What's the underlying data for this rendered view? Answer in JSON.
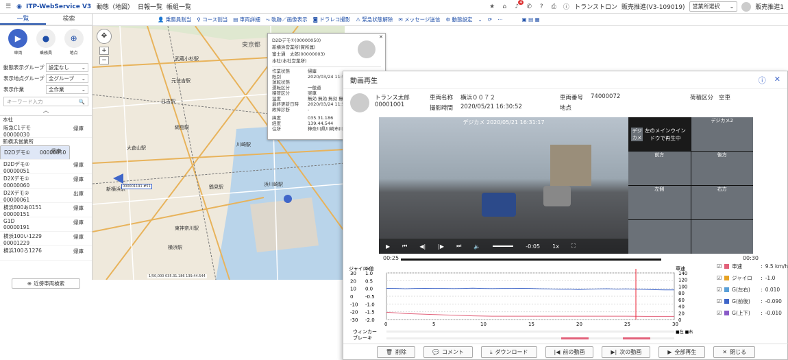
{
  "topbar": {
    "logo": "ITP-WebService V3",
    "menu": [
      "動態（地図）",
      "日報一覧",
      "帳組一覧"
    ],
    "company": "トランストロン",
    "sales": "販売推進(V3-109019)",
    "office": "営業所選択",
    "user": "販売推進1",
    "badge": "4"
  },
  "toolbar": [
    "乗務員割当",
    "コース割当",
    "車両詳細",
    "軌跡／画像表示",
    "ドラレコ撮影",
    "緊急状態解除",
    "メッセージ送信",
    "動態設定"
  ],
  "left": {
    "tabs": [
      "一覧",
      "検索"
    ],
    "modes": [
      {
        "label": "車両"
      },
      {
        "label": "乗務員"
      },
      {
        "label": "地点"
      }
    ],
    "filters": [
      {
        "label": "動態表示グループ",
        "value": "設定なし"
      },
      {
        "label": "表示地点グループ",
        "value": "全グループ"
      },
      {
        "label": "表示作業",
        "value": "全作業"
      }
    ],
    "keyword_placeholder": "キーワード入力",
    "groups": [
      {
        "name": "本社",
        "vehicles": [
          {
            "name": "阪急C1デモ",
            "id": "00000030",
            "status": "帰庫"
          }
        ]
      },
      {
        "name": "新横浜営業所",
        "vehicles": [
          {
            "name": "D2Dデモ①",
            "id": "00000050",
            "status": "帰庫",
            "selected": true
          },
          {
            "name": "D2Dデモ②",
            "id": "00000051",
            "status": "帰庫"
          },
          {
            "name": "D2Xデモ①",
            "id": "00000060",
            "status": "帰庫"
          },
          {
            "name": "D2Xデモ②",
            "id": "00000061",
            "status": "出庫"
          },
          {
            "name": "横浜800あ0151",
            "id": "00000151",
            "status": "帰庫"
          },
          {
            "name": "G1D",
            "id": "00000191",
            "status": "帰庫"
          },
          {
            "name": "横浜100い1229",
            "id": "00001229",
            "status": "帰庫"
          },
          {
            "name": "横浜100ろ1276",
            "id": "",
            "status": "帰庫"
          }
        ]
      }
    ],
    "near_btn": "近傍車両検索"
  },
  "map": {
    "scale": "1/50,000 035.31.186 139.44.544",
    "place_labels": [
      "東京都",
      "武蔵小杉駅",
      "元住吉駅",
      "日吉駅",
      "大倉山駅",
      "新横浜駅",
      "綱島駅",
      "鶴見駅",
      "川崎駅",
      "浜川崎駅",
      "東神奈川駅",
      "横浜駅"
    ],
    "marker_label": "000001191 #51"
  },
  "popup": {
    "title": "D2Dデモ①(00000050)",
    "office": "新横浜営業所(賀所属)",
    "driver": "富士通　太郎(00000003)",
    "company": "本社(本社営業所)",
    "rows": [
      {
        "k": "作業状態",
        "v": "帰庫"
      },
      {
        "k": "既別",
        "v": "2020/03/24 11:57"
      },
      {
        "k": "運転状態",
        "v": ""
      },
      {
        "k": "運転区分",
        "v": "一般道"
      },
      {
        "k": "積荷区分",
        "v": "実車"
      },
      {
        "k": "温度",
        "v": "無効 無効 無効 無効"
      },
      {
        "k": "最終更新日時",
        "v": "2020/03/24 11:57"
      },
      {
        "k": "故障診断",
        "v": "-"
      },
      {
        "k": "緯度",
        "v": "035.31.186"
      },
      {
        "k": "経度",
        "v": "139.44.544"
      },
      {
        "k": "住所",
        "v": "神奈川県川崎市川崎"
      }
    ]
  },
  "dialog": {
    "title": "動画再生",
    "driver": "トランス太郎",
    "driver_id": "00001001",
    "vehicle_label": "車両名称",
    "vehicle": "横浜００７２",
    "shot_label": "撮影時間",
    "shot_time": "2020/05/21 16:30:52",
    "vno_label": "車両番号",
    "vno": "74000072",
    "area_label": "地点",
    "cargo_label": "荷積区分",
    "cargo": "空車",
    "video_caption": "デジカメ 2020/05/21 16:31:17",
    "thumb_title_main": "デジカメ",
    "thumb_title_2": "デジカメ2",
    "thumb_msg": "左のメインウインドウで再生中",
    "thumbs": [
      "前方",
      "後方",
      "左側",
      "右方"
    ],
    "time_left": "00:25",
    "time_right": "00:30",
    "ctrl_time": "-0:05",
    "speed": "1x",
    "chart_ylabel_left": "ジャイロ",
    "chart_ylabel_g": "G値",
    "chart_ylabel_right": "車速",
    "winker": "ウィンカー",
    "brake": "ブレーキ",
    "winker_legend": "■左 ■右",
    "legend": [
      {
        "name": "車速",
        "val": "9.5 km/h",
        "color": "#e2617a"
      },
      {
        "name": "ジャイロ",
        "val": "-1.0",
        "color": "#e6a224"
      },
      {
        "name": "G(左右)",
        "val": "0.010",
        "color": "#5aa0d8"
      },
      {
        "name": "G(前後)",
        "val": "-0.090",
        "color": "#3f66c9"
      },
      {
        "name": "G(上下)",
        "val": "-0.010",
        "color": "#8a5ac8"
      }
    ],
    "buttons": [
      "削除",
      "コメント",
      "ダウンロード",
      "前の動画",
      "次の動画",
      "全部再生",
      "閉じる"
    ]
  },
  "chart_data": {
    "type": "line",
    "x_ticks": [
      0,
      5,
      10,
      15,
      20,
      25,
      30
    ],
    "gyro_ticks": [
      30,
      20,
      10,
      0,
      -10,
      -20,
      -30
    ],
    "g_ticks": [
      "1.0",
      "0.5",
      "0.0",
      "-0.5",
      "-1.0",
      "-1.5",
      "-2.0"
    ],
    "speed_ticks": [
      140,
      120,
      100,
      80,
      60,
      40,
      20,
      0
    ],
    "series": [
      {
        "name": "車速",
        "values": [
          22,
          20,
          18,
          17,
          16,
          15,
          14,
          13,
          12,
          11,
          10.5,
          10,
          10,
          10,
          10,
          10,
          10,
          10,
          10,
          10,
          10,
          10,
          10,
          10,
          10,
          10,
          9.8,
          9.6,
          9.5,
          9.5,
          9.5
        ]
      },
      {
        "name": "G(前後)",
        "values": [
          0.01,
          0.0,
          -0.02,
          0.0,
          0.01,
          0.0,
          0.0,
          -0.01,
          0.0,
          0.02,
          0.0,
          -0.01,
          0.0,
          0.0,
          0.01,
          0.0,
          -0.02,
          -0.03,
          -0.05,
          -0.04,
          -0.07,
          -0.05,
          -0.03,
          -0.02,
          -0.04,
          -0.03,
          -0.05,
          -0.06,
          -0.08,
          -0.09,
          -0.09
        ]
      }
    ],
    "cursor_x": 26
  }
}
